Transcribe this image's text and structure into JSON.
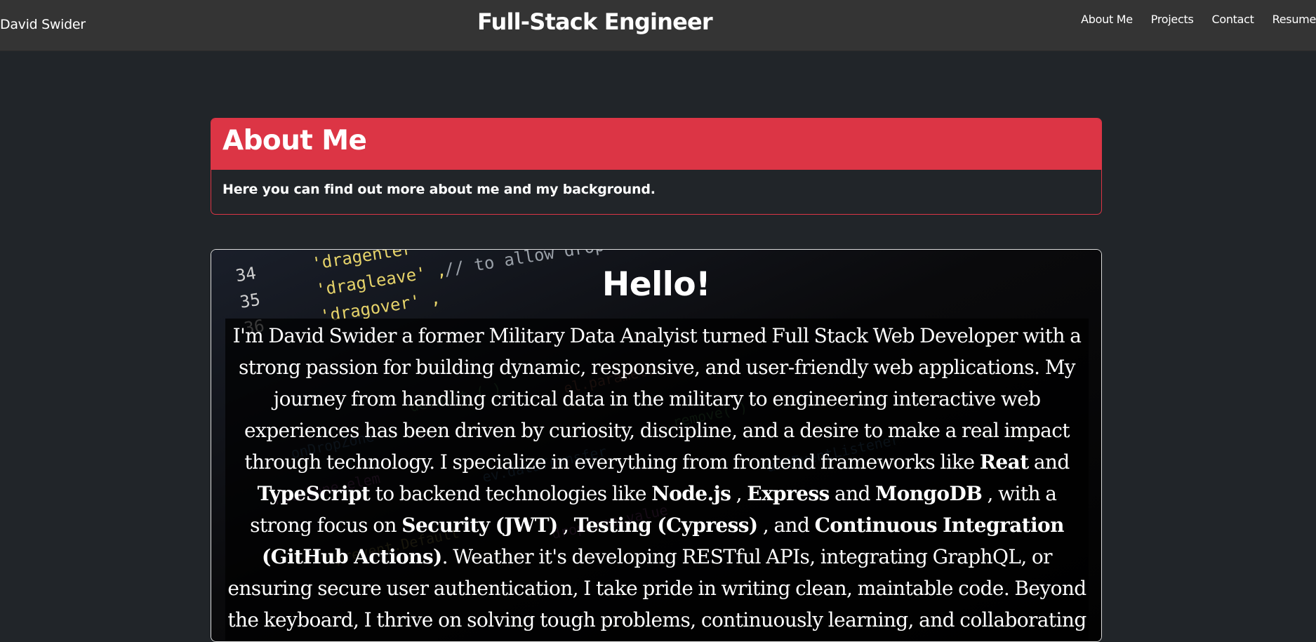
{
  "nav": {
    "brand": "David Swider",
    "title": "Full-Stack Engineer",
    "links": [
      "About Me",
      "Projects",
      "Contact",
      "Resume"
    ]
  },
  "about_card": {
    "title": "About Me",
    "subtitle": "Here you can find out more about me and my background."
  },
  "hello_card": {
    "title": "Hello!",
    "bio": {
      "p1": "I'm David Swider a former Military Data Analyist turned Full Stack Web Developer with a strong passion for building dynamic, responsive, and user-friendly web applications. My journey from handling critical data in the military to engineering interactive web experiences has been driven by curiosity, discipline, and a desire to make a real impact through technology. I specialize in everything from frontend frameworks like ",
      "react": "Reat",
      "and1": " and ",
      "typescript": "TypeScript",
      "p2": " to backend technologies like ",
      "node": "Node.js",
      "comma1": " , ",
      "express": "Express",
      "and2": " and ",
      "mongo": "MongoDB",
      "p3": " , with a strong focus on ",
      "security": "Security (JWT)",
      "comma2": " , ",
      "testing": "Testing (Cypress)",
      "p4": " , and ",
      "ci": "Continuous Integration (GitHub Actions)",
      "p5": ". Weather it's developing RESTful APIs, integrating GraphQL, or ensuring secure user authentication, I take pride in writing clean, maintable code. Beyond the keyboard, I thrive on solving tough problems, continuously learning, and collaborating with others. I"
    },
    "code_lines": {
      "n34": "34",
      "n35": "35",
      "n36": "36",
      "dragenter": "'dragenter'",
      "dragleave": "'dragleave' ,",
      "dragover": "'dragover' ,",
      "comment": "// to allow drop"
    }
  },
  "colors": {
    "navbar_bg": "#343434",
    "page_bg": "#212529",
    "accent_red": "#dc3545"
  }
}
